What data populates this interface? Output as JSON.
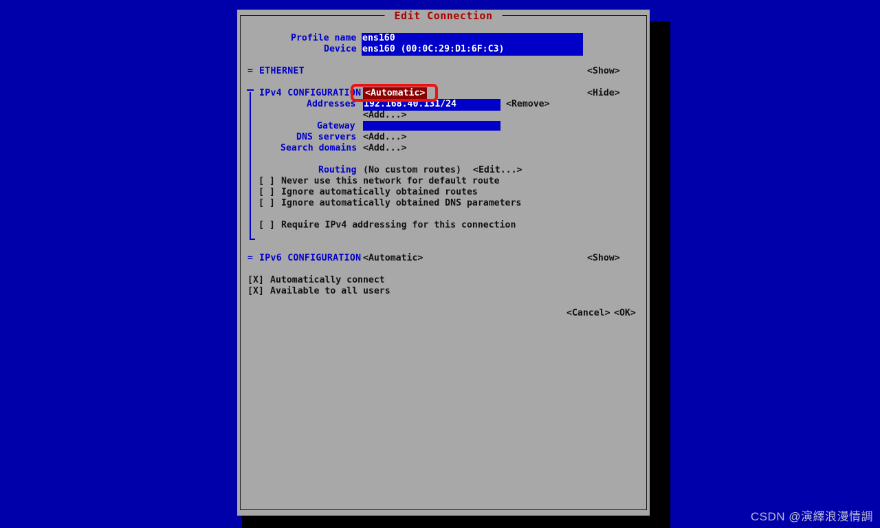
{
  "window": {
    "title": "Edit Connection",
    "title_color": "#aa0000",
    "bg_color": "#a8a8a8",
    "desktop_color": "#0000aa"
  },
  "form": {
    "profile_name": {
      "label": "Profile name",
      "value": "ens160"
    },
    "device": {
      "label": "Device",
      "value": "ens160 (00:0C:29:D1:6F:C3)"
    }
  },
  "sections": {
    "ethernet": {
      "marker": "=",
      "label": "ETHERNET",
      "toggle": "<Show>"
    },
    "ipv4": {
      "marker": "⊤",
      "label": "IPv4 CONFIGURATION",
      "mode": "<Automatic>",
      "mode_bg": "#8b0000",
      "mode_fg": "#ffffff",
      "toggle": "<Hide>",
      "addresses_label": "Addresses",
      "addresses_value": "192.168.40.131/24",
      "addresses_remove": "<Remove>",
      "addresses_add": "<Add...>",
      "gateway_label": "Gateway",
      "gateway_value": "",
      "dns_label": "DNS servers",
      "dns_add": "<Add...>",
      "search_label": "Search domains",
      "search_add": "<Add...>",
      "routing_label": "Routing",
      "routing_status": "(No custom routes)",
      "routing_edit": "<Edit...>",
      "checkboxes": [
        {
          "mark": "[ ]",
          "label": "Never use this network for default route",
          "checked": false
        },
        {
          "mark": "[ ]",
          "label": "Ignore automatically obtained routes",
          "checked": false
        },
        {
          "mark": "[ ]",
          "label": "Ignore automatically obtained DNS parameters",
          "checked": false
        },
        {
          "mark": "[ ]",
          "label": "Require IPv4 addressing for this connection",
          "checked": false
        }
      ]
    },
    "ipv6": {
      "marker": "=",
      "label": "IPv6 CONFIGURATION",
      "mode": "<Automatic>",
      "toggle": "<Show>"
    }
  },
  "options": [
    {
      "mark": "[X]",
      "label": "Automatically connect",
      "checked": true
    },
    {
      "mark": "[X]",
      "label": "Available to all users",
      "checked": true
    }
  ],
  "buttons": {
    "cancel": "<Cancel>",
    "ok": "<OK>"
  },
  "annotation": {
    "type": "red-rounded-rectangle",
    "target": "ipv4-mode-select",
    "color": "#ee1111"
  },
  "watermark": {
    "text": "CSDN @演繹浪漫情調"
  }
}
